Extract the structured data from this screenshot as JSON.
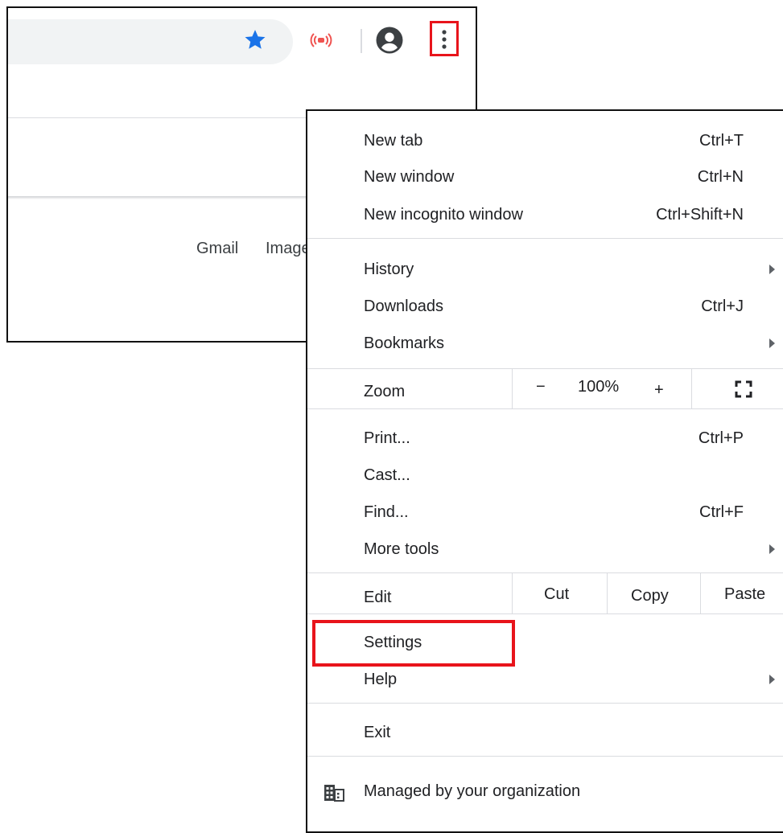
{
  "browser": {
    "top_links": {
      "gmail": "Gmail",
      "images": "Images"
    }
  },
  "menu": {
    "items": {
      "new_tab": {
        "label": "New tab",
        "shortcut": "Ctrl+T"
      },
      "new_window": {
        "label": "New window",
        "shortcut": "Ctrl+N"
      },
      "new_incognito": {
        "label": "New incognito window",
        "shortcut": "Ctrl+Shift+N"
      },
      "history": {
        "label": "History"
      },
      "downloads": {
        "label": "Downloads",
        "shortcut": "Ctrl+J"
      },
      "bookmarks": {
        "label": "Bookmarks"
      },
      "print": {
        "label": "Print...",
        "shortcut": "Ctrl+P"
      },
      "cast": {
        "label": "Cast..."
      },
      "find": {
        "label": "Find...",
        "shortcut": "Ctrl+F"
      },
      "more_tools": {
        "label": "More tools"
      },
      "settings": {
        "label": "Settings"
      },
      "help": {
        "label": "Help"
      },
      "exit": {
        "label": "Exit"
      }
    },
    "zoom": {
      "label": "Zoom",
      "minus": "−",
      "value": "100%",
      "plus": "+"
    },
    "edit": {
      "label": "Edit",
      "cut": "Cut",
      "copy": "Copy",
      "paste": "Paste"
    },
    "managed": "Managed by your organization"
  },
  "colors": {
    "accent_red": "#e8141b",
    "star_blue": "#1a73e8"
  },
  "icons": [
    "star-icon",
    "cast-icon",
    "account-circle-icon",
    "kebab-menu-icon",
    "fullscreen-icon",
    "submenu-arrow-icon",
    "building-icon"
  ]
}
